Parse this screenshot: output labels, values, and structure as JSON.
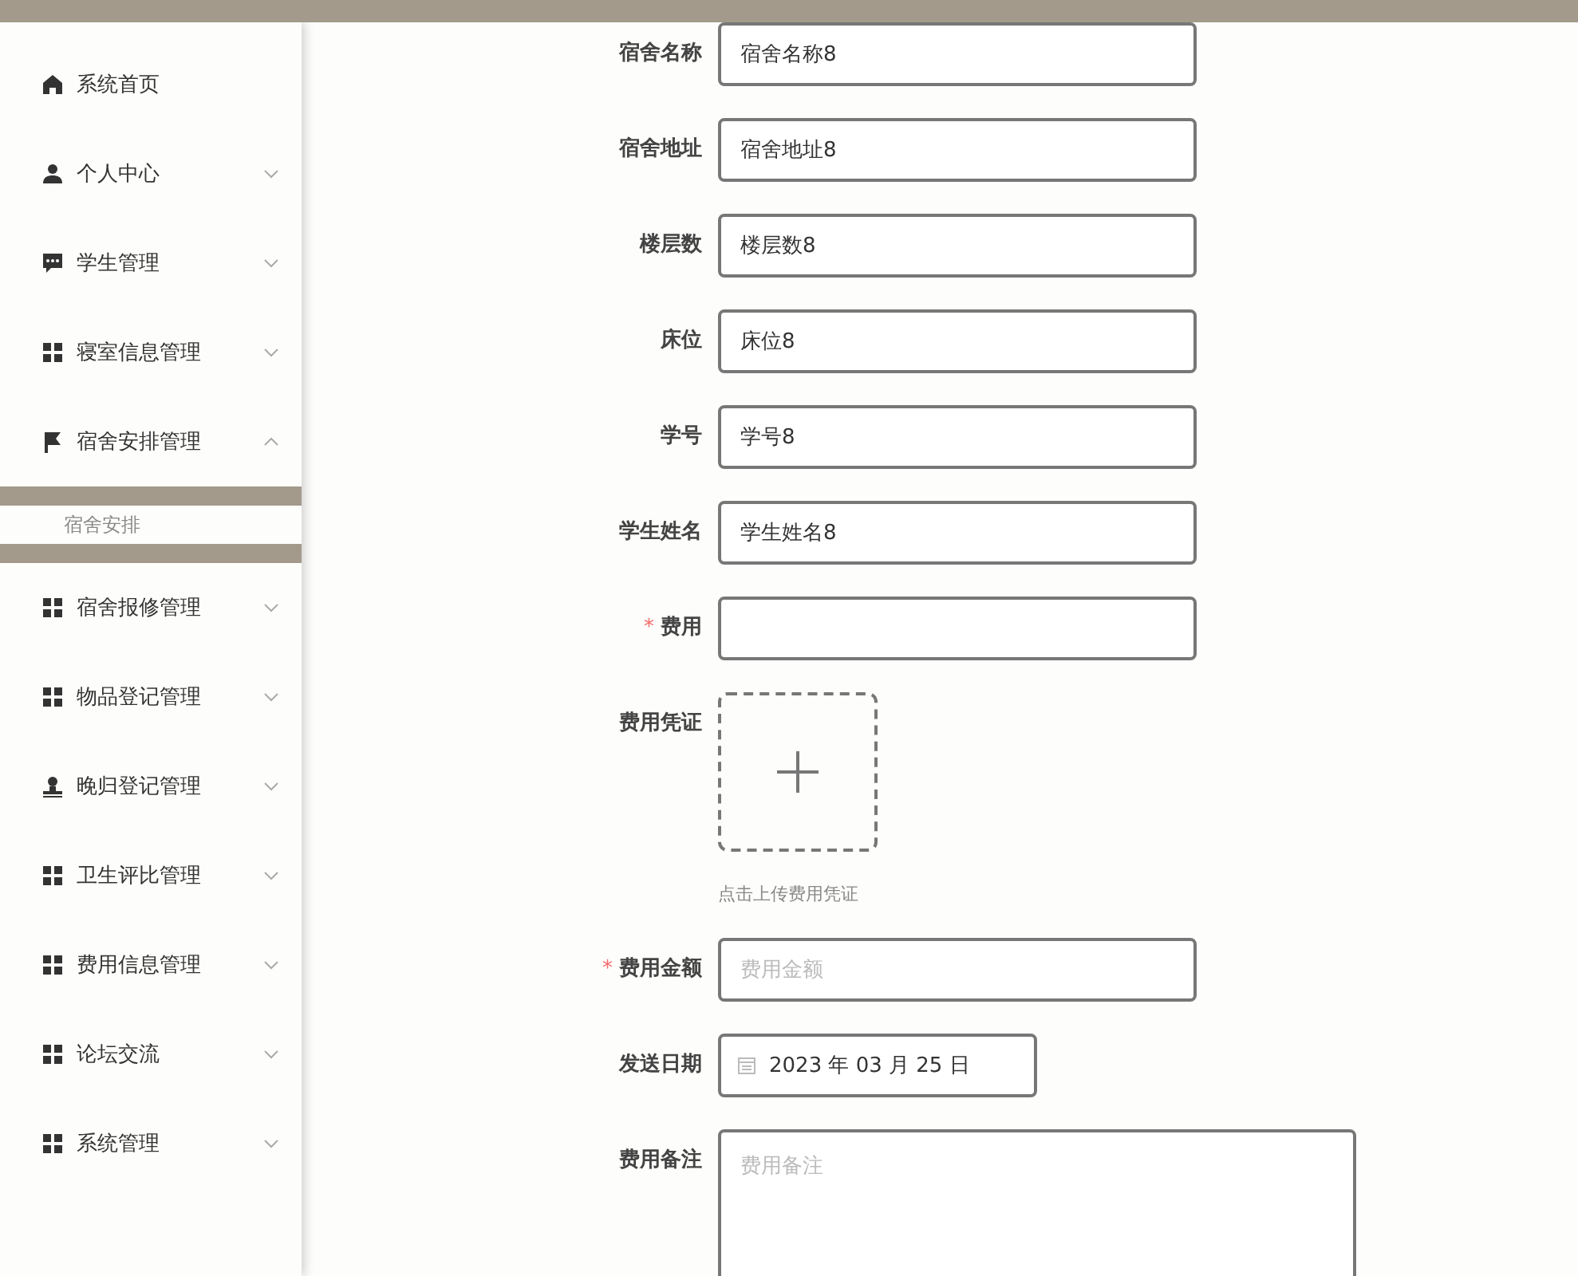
{
  "sidebar": {
    "items": [
      {
        "label": "系统首页",
        "kind": "home"
      },
      {
        "label": "个人中心",
        "kind": "user",
        "expanded": false
      },
      {
        "label": "学生管理",
        "kind": "chat",
        "expanded": false
      },
      {
        "label": "寝室信息管理",
        "kind": "grid",
        "expanded": false
      },
      {
        "label": "宿舍安排管理",
        "kind": "flag",
        "expanded": true,
        "children": [
          {
            "label": "宿舍安排",
            "selected": false
          }
        ]
      },
      {
        "label": "宿舍报修管理",
        "kind": "grid",
        "expanded": false
      },
      {
        "label": "物品登记管理",
        "kind": "grid",
        "expanded": false
      },
      {
        "label": "晚归登记管理",
        "kind": "stamp",
        "expanded": false
      },
      {
        "label": "卫生评比管理",
        "kind": "grid",
        "expanded": false
      },
      {
        "label": "费用信息管理",
        "kind": "grid",
        "expanded": false
      },
      {
        "label": "论坛交流",
        "kind": "grid",
        "expanded": false
      },
      {
        "label": "系统管理",
        "kind": "grid",
        "expanded": false
      }
    ]
  },
  "form": {
    "fields": [
      {
        "kind": "text",
        "label": "宿舍名称",
        "value": "宿舍名称8"
      },
      {
        "kind": "text",
        "label": "宿舍地址",
        "value": "宿舍地址8"
      },
      {
        "kind": "text",
        "label": "楼层数",
        "value": "楼层数8"
      },
      {
        "kind": "text",
        "label": "床位",
        "value": "床位8"
      },
      {
        "kind": "text",
        "label": "学号",
        "value": "学号8"
      },
      {
        "kind": "text",
        "label": "学生姓名",
        "value": "学生姓名8"
      },
      {
        "kind": "text",
        "label": "费用",
        "required_mark": "*"
      },
      {
        "kind": "upload",
        "label": "费用凭证",
        "hint": "点击上传费用凭证"
      },
      {
        "kind": "text",
        "label": "费用金额",
        "placeholder": "费用金额",
        "required_mark": "*"
      },
      {
        "kind": "date",
        "label": "发送日期",
        "value": "2023 年 03 月 25 日"
      },
      {
        "kind": "textarea",
        "label": "费用备注",
        "placeholder": "费用备注"
      }
    ]
  }
}
